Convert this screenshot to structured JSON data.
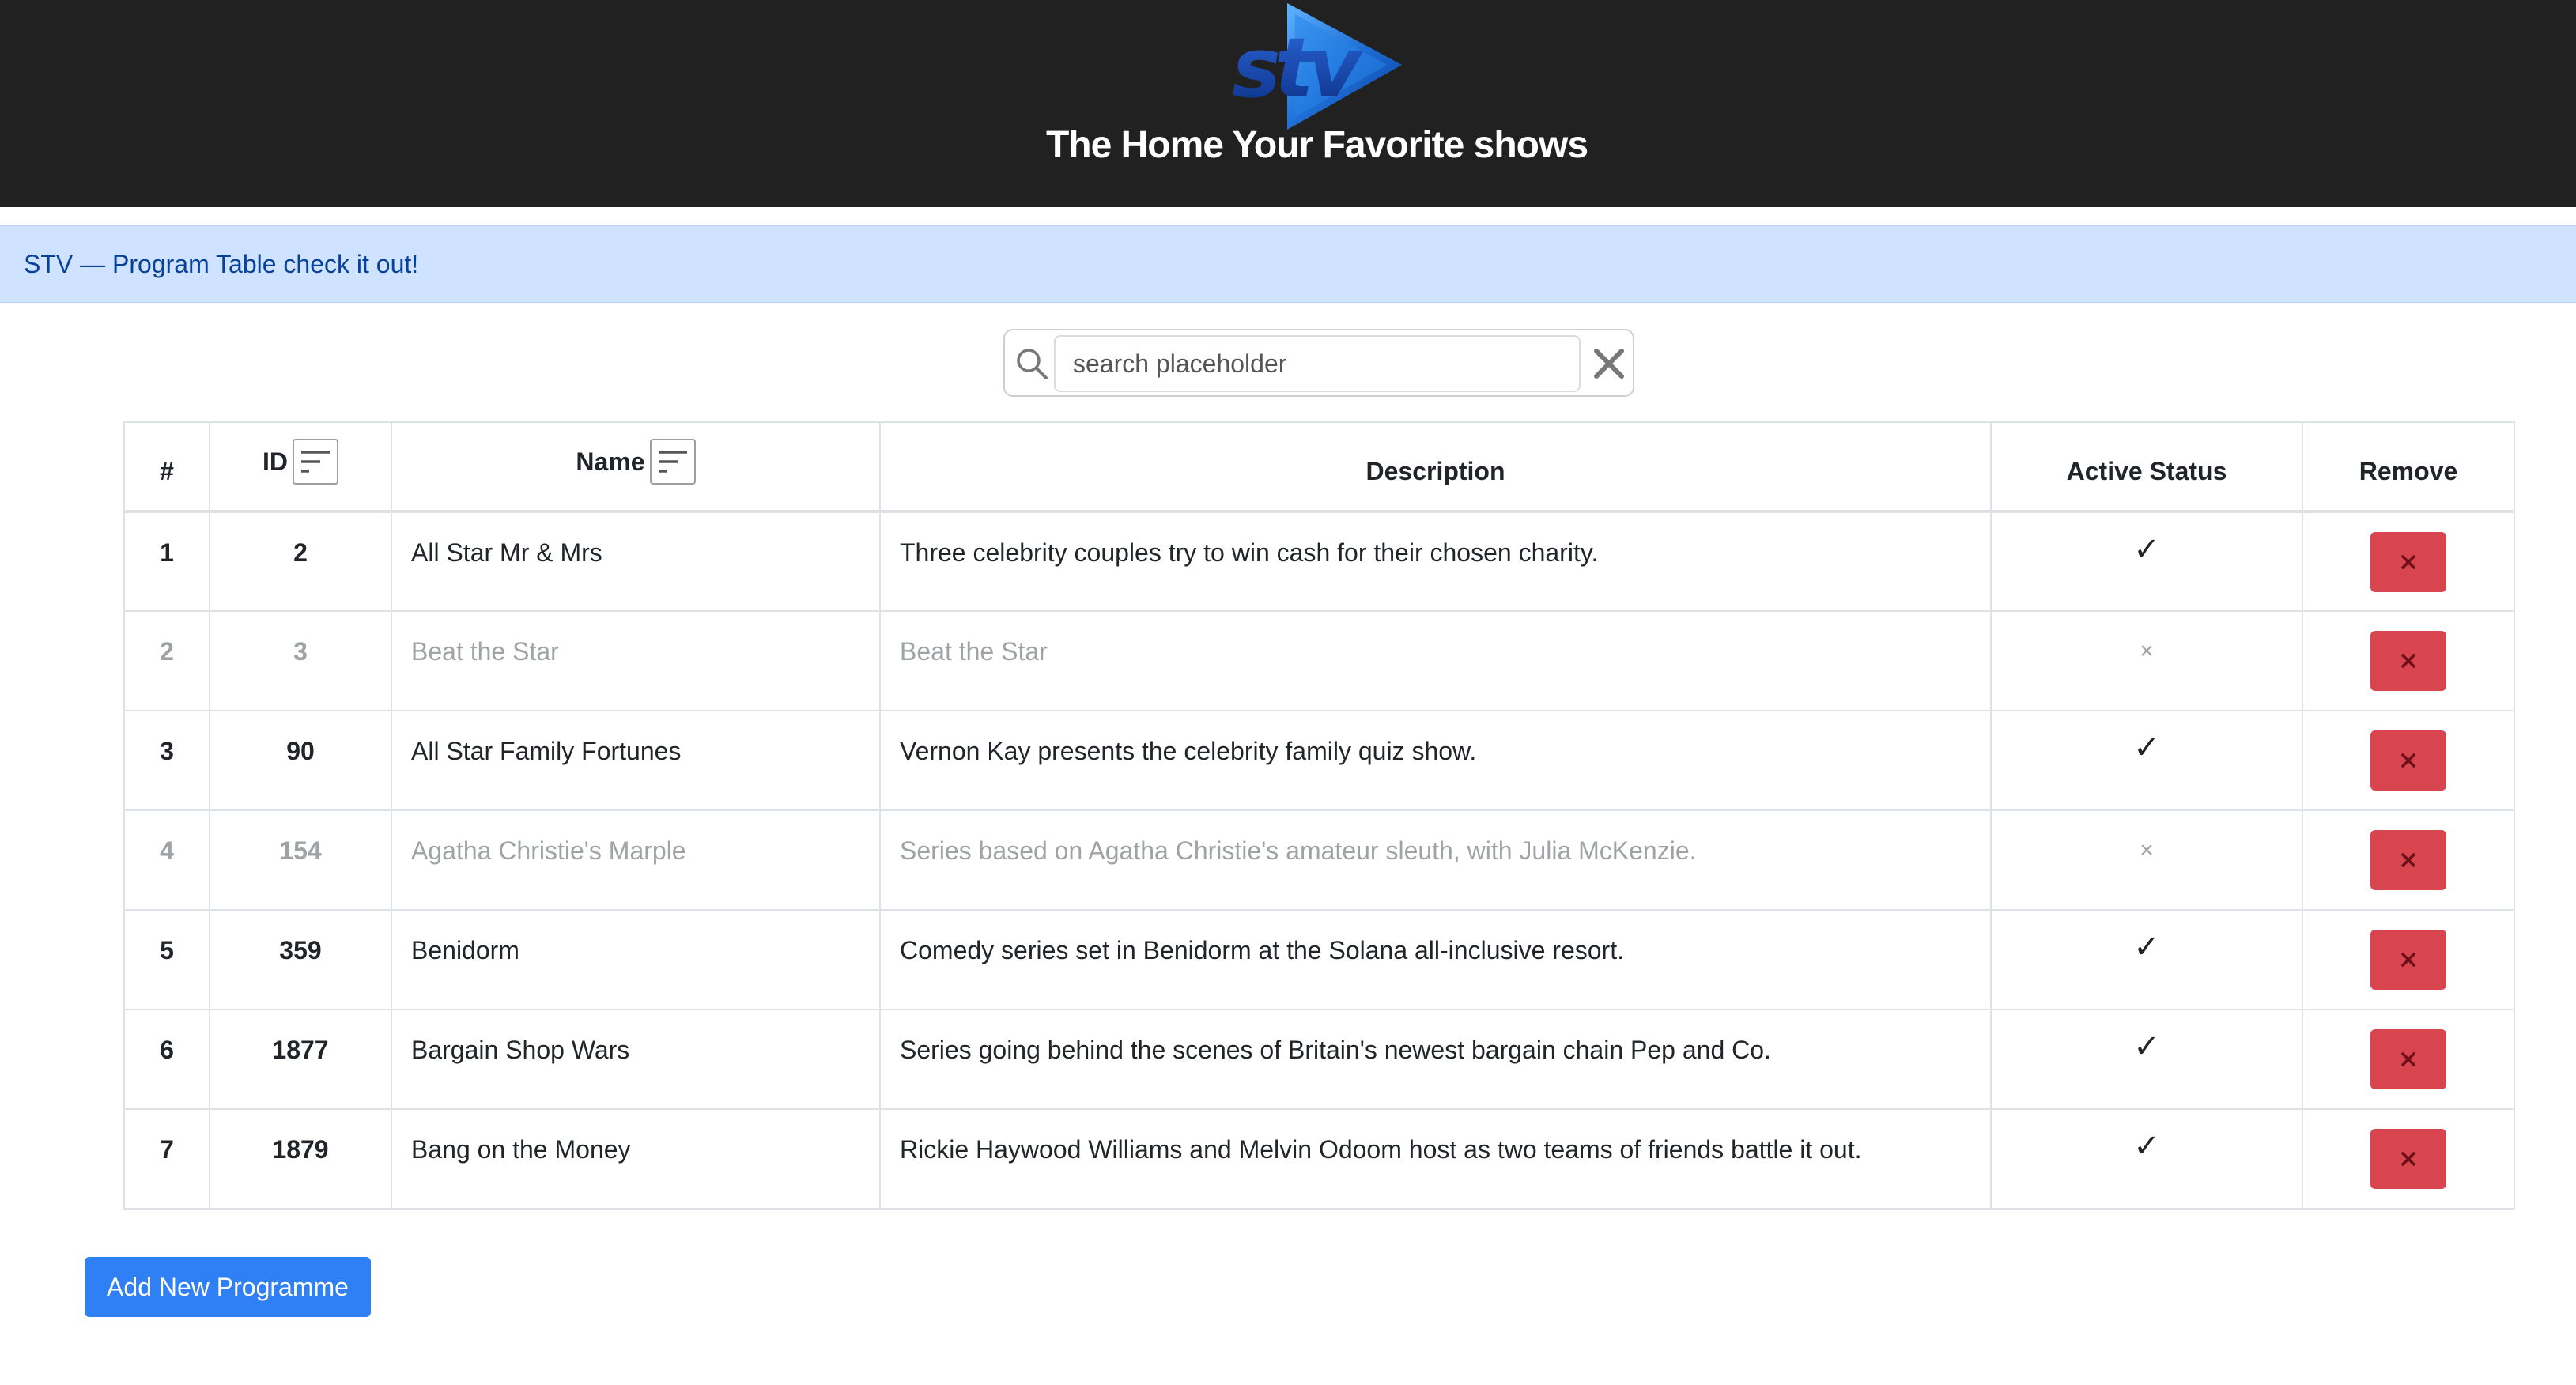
{
  "header": {
    "logo_text": "stv",
    "title": "The Home Your Favorite shows"
  },
  "banner": {
    "text": "STV — Program Table check it out!"
  },
  "search": {
    "placeholder": "search placeholder",
    "value": ""
  },
  "table": {
    "columns": {
      "num": "#",
      "id": "ID",
      "name": "Name",
      "description": "Description",
      "active_status": "Active Status",
      "remove": "Remove"
    },
    "status_symbols": {
      "active": "✓",
      "inactive": "×"
    },
    "rows": [
      {
        "num": "1",
        "id": "2",
        "name": "All Star Mr & Mrs",
        "description": "Three celebrity couples try to win cash for their chosen charity.",
        "active": true
      },
      {
        "num": "2",
        "id": "3",
        "name": "Beat the Star",
        "description": "Beat the Star",
        "active": false
      },
      {
        "num": "3",
        "id": "90",
        "name": "All Star Family Fortunes",
        "description": "Vernon Kay presents the celebrity family quiz show.",
        "active": true
      },
      {
        "num": "4",
        "id": "154",
        "name": "Agatha Christie's Marple",
        "description": "Series based on Agatha Christie's amateur sleuth, with Julia McKenzie.",
        "active": false
      },
      {
        "num": "5",
        "id": "359",
        "name": "Benidorm",
        "description": "Comedy series set in Benidorm at the Solana all-inclusive resort.",
        "active": true
      },
      {
        "num": "6",
        "id": "1877",
        "name": "Bargain Shop Wars",
        "description": "Series going behind the scenes of Britain's newest bargain chain Pep and Co.",
        "active": true
      },
      {
        "num": "7",
        "id": "1879",
        "name": "Bang on the Money",
        "description": "Rickie Haywood Williams and Melvin Odoom host as two teams of friends battle it out.",
        "active": true
      }
    ]
  },
  "actions": {
    "add_label": "Add New Programme"
  },
  "colors": {
    "header_bg": "#212121",
    "banner_bg": "#cfe2ff",
    "banner_text": "#084298",
    "remove_button": "#d9454f",
    "primary_button": "#2f7ff5",
    "inactive_text": "#a0a3a6"
  },
  "icons": {
    "logo": "stv-logo",
    "search": "search-icon",
    "clear": "clear-icon",
    "sort": "sort-icon",
    "remove": "close-icon"
  }
}
